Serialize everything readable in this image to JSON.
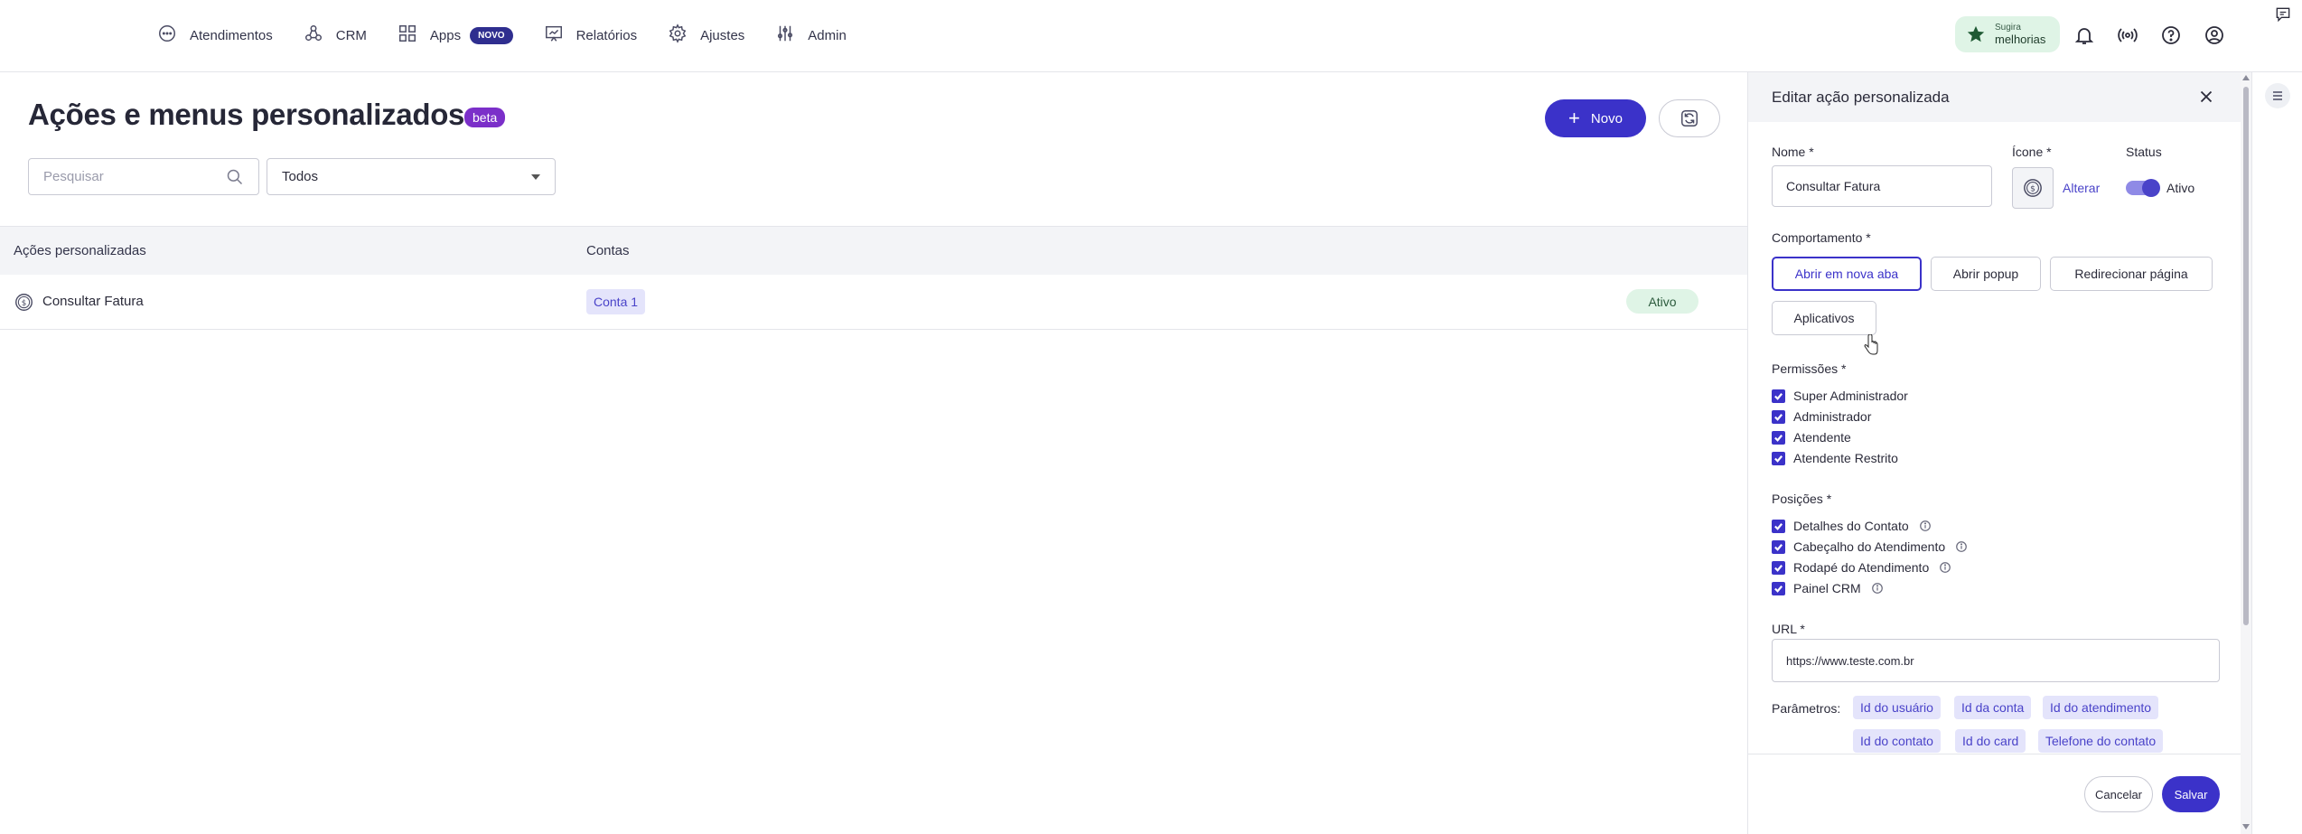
{
  "nav": {
    "items": [
      {
        "label": "Atendimentos",
        "icon": "chat-bubble-icon"
      },
      {
        "label": "CRM",
        "icon": "crm-nodes-icon"
      },
      {
        "label": "Apps",
        "icon": "apps-grid-icon",
        "badge": "NOVO"
      },
      {
        "label": "Relatórios",
        "icon": "chart-board-icon"
      },
      {
        "label": "Ajustes",
        "icon": "gear-icon"
      },
      {
        "label": "Admin",
        "icon": "sliders-icon"
      }
    ],
    "suggest": {
      "line1": "Sugira",
      "line2": "melhorias"
    }
  },
  "page": {
    "title": "Ações e menus personalizados",
    "beta": "beta",
    "new_button": "Novo",
    "search_placeholder": "Pesquisar",
    "filter_value": "Todos"
  },
  "table": {
    "columns": [
      "Ações personalizadas",
      "Contas"
    ],
    "rows": [
      {
        "name": "Consultar Fatura",
        "account": "Conta 1",
        "status": "Ativo",
        "icon": "dollar-circle-icon"
      }
    ]
  },
  "panel": {
    "title": "Editar ação personalizada",
    "name_label": "Nome *",
    "name_value": "Consultar Fatura",
    "icon_label": "Ícone *",
    "icon_change": "Alterar",
    "status_label": "Status",
    "status_value": "Ativo",
    "status_on": true,
    "behavior_label": "Comportamento *",
    "behaviors": [
      {
        "label": "Abrir em nova aba",
        "selected": true
      },
      {
        "label": "Abrir popup",
        "selected": false
      },
      {
        "label": "Redirecionar página",
        "selected": false
      },
      {
        "label": "Aplicativos",
        "selected": false
      }
    ],
    "permissions_label": "Permissões *",
    "permissions": [
      "Super Administrador",
      "Administrador",
      "Atendente",
      "Atendente Restrito"
    ],
    "positions_label": "Posições *",
    "positions": [
      "Detalhes do Contato",
      "Cabeçalho do Atendimento",
      "Rodapé do Atendimento",
      "Painel CRM"
    ],
    "url_label": "URL *",
    "url_value": "https://www.teste.com.br",
    "params_label": "Parâmetros:",
    "params": [
      "Id do usuário",
      "Id da conta",
      "Id do atendimento",
      "Id do contato",
      "Id do card",
      "Telefone do contato"
    ],
    "cancel": "Cancelar",
    "save": "Salvar"
  },
  "colors": {
    "primary": "#3b32c9",
    "beta_badge": "#7b2fc9",
    "status_green_bg": "#dff4e6",
    "chip_bg": "#e4e4fb"
  }
}
